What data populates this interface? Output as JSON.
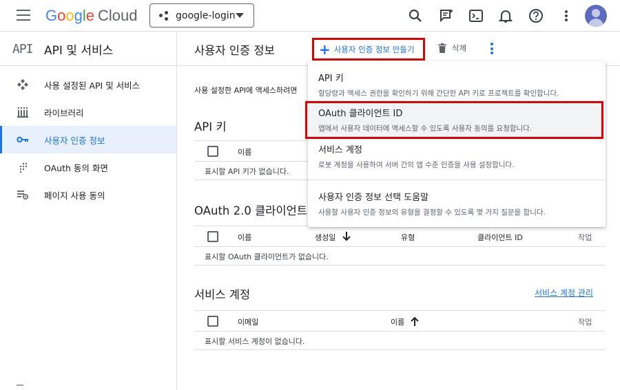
{
  "topbar": {
    "logo": {
      "g1": "G",
      "g2": "o",
      "g3": "o",
      "g4": "g",
      "g5": "l",
      "g6": "e",
      "cloud": "Cloud"
    },
    "project": "google-login",
    "icons": [
      "search-icon",
      "cloud-shell-assist-icon",
      "terminal-icon",
      "bell-icon",
      "help-icon",
      "more-vert-icon",
      "avatar"
    ]
  },
  "sidebar": {
    "logo": "API",
    "title": "API 및 서비스",
    "items": [
      {
        "label": "사용 설정된 API 및 서비스",
        "icon": "diamond-icon"
      },
      {
        "label": "라이브러리",
        "icon": "library-icon"
      },
      {
        "label": "사용자 인증 정보",
        "icon": "key-icon",
        "active": true
      },
      {
        "label": "OAuth 동의 화면",
        "icon": "dots-grid-icon"
      },
      {
        "label": "페이지 사용 동의",
        "icon": "settings-list-icon"
      }
    ]
  },
  "header": {
    "title": "사용자 인증 정보",
    "create_label": "사용자 인증 정보 만들기",
    "delete_label": "삭제"
  },
  "main": {
    "intro": "사용 설정한 API에 액세스하려면",
    "api_keys": {
      "title": "API 키",
      "columns": [
        "이름"
      ],
      "empty": "표시할 API 키가 없습니다."
    },
    "oauth": {
      "title": "OAuth 2.0 클라이언트",
      "columns": [
        "이름",
        "생성일",
        "유형",
        "클라이언트 ID",
        "작업"
      ],
      "empty": "표시할 OAuth 클라이언트가 없습니다."
    },
    "service_accounts": {
      "title": "서비스 계정",
      "manage_link": "서비스 계정 관리",
      "columns": [
        "이메일",
        "이름",
        "작업"
      ],
      "empty": "표시할 서비스 계정이 없습니다."
    }
  },
  "dropdown": {
    "items": [
      {
        "title": "API 키",
        "desc": "할당량과 액세스 권한을 확인하기 위해 간단한 API 키로 프로젝트를 확인합니다."
      },
      {
        "title": "OAuth 클라이언트 ID",
        "desc": "앱에서 사용자 데이터에 액세스할 수 있도록 사용자 동의를 요청합니다.",
        "highlighted": true
      },
      {
        "title": "서비스 계정",
        "desc": "로봇 계정을 사용하여 서버 간의 앱 수준 인증을 사용 설정합니다."
      },
      {
        "title": "사용자 인증 정보 선택 도움말",
        "desc": "사용할 사용자 인증 정보의 유형을 결정할 수 있도록 몇 가지 질문을 합니다."
      }
    ]
  },
  "colors": {
    "accent": "#1a73e8",
    "highlight_box": "#e00000",
    "active_bg": "#e8f0fe"
  }
}
